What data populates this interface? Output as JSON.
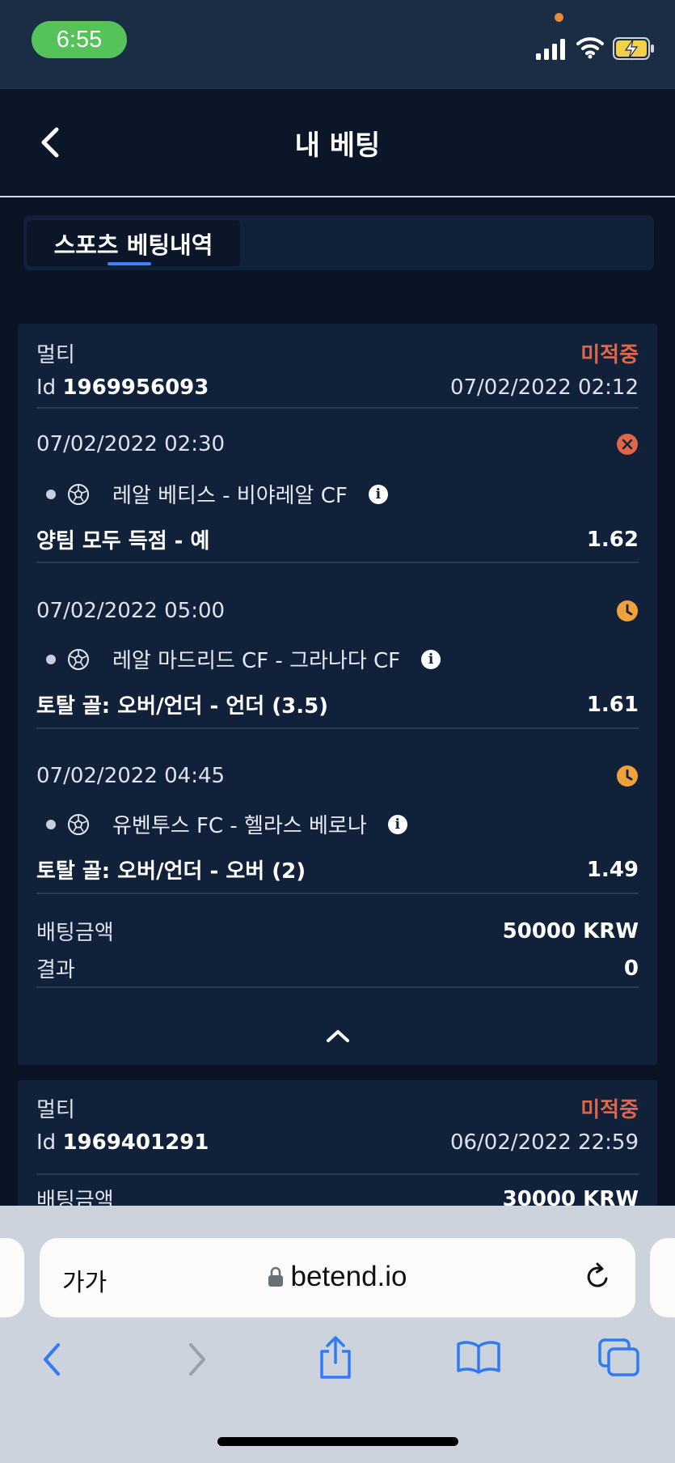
{
  "status_bar": {
    "time": "6:55"
  },
  "header": {
    "title": "내 베팅",
    "back_icon": "chevron-left-icon"
  },
  "tabs": [
    {
      "label": "스포츠 베팅내역",
      "active": true
    }
  ],
  "bets": [
    {
      "type": "멀티",
      "status": "미적중",
      "id_label": "Id",
      "id": "1969956093",
      "placed_at": "07/02/2022 02:12",
      "selections": [
        {
          "time": "07/02/2022 02:30",
          "status_icon": "lost-x-icon",
          "event": "레알 베티스 - 비야레알 CF",
          "market": "양팀 모두 득점 - 예",
          "odds": "1.62"
        },
        {
          "time": "07/02/2022 05:00",
          "status_icon": "pending-clock-icon",
          "event": "레알 마드리드 CF - 그라나다 CF",
          "market": "토탈 골: 오버/언더 - 언더 (3.5)",
          "odds": "1.61"
        },
        {
          "time": "07/02/2022 04:45",
          "status_icon": "pending-clock-icon",
          "event": "유벤투스 FC - 헬라스 베로나",
          "market": "토탈 골: 오버/언더 - 오버 (2)",
          "odds": "1.49"
        }
      ],
      "stake_label": "배팅금액",
      "stake": "50000 KRW",
      "result_label": "결과",
      "result": "0"
    },
    {
      "type": "멀티",
      "status": "미적중",
      "id_label": "Id",
      "id": "1969401291",
      "placed_at": "06/02/2022 22:59",
      "stake_label": "배팅금액",
      "stake": "30000 KRW"
    }
  ],
  "browser": {
    "text_size_label": "가가",
    "url": "betend.io"
  },
  "colors": {
    "background": "#0a1424",
    "card": "#12213a",
    "status_lost": "#e0664a",
    "pending": "#f0a23a",
    "tab_accent": "#3f84f2",
    "time_pill": "#55c25a"
  }
}
